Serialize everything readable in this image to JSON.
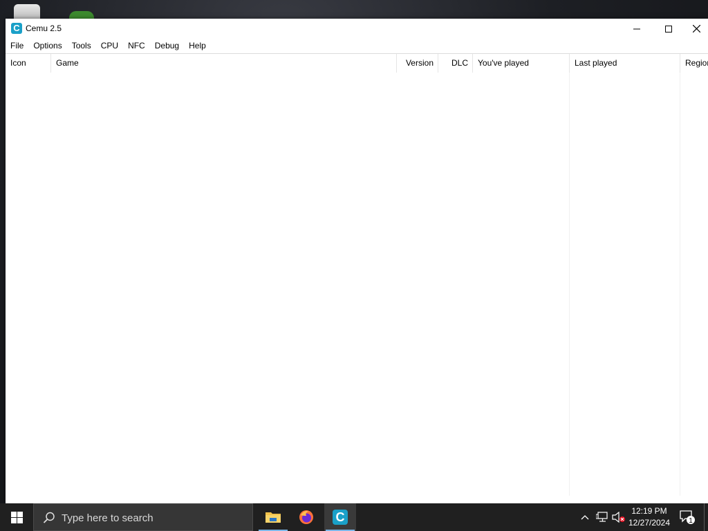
{
  "window": {
    "title": "Cemu 2.5",
    "app_icon_letter": "C"
  },
  "menu": {
    "items": [
      "File",
      "Options",
      "Tools",
      "CPU",
      "NFC",
      "Debug",
      "Help"
    ]
  },
  "game_list": {
    "columns": [
      "Icon",
      "Game",
      "Version",
      "DLC",
      "You've played",
      "Last played",
      "Region"
    ],
    "rows": []
  },
  "taskbar": {
    "search_placeholder": "Type here to search",
    "pinned": [
      {
        "name": "File Explorer",
        "icon": "folder-icon"
      },
      {
        "name": "Firefox",
        "icon": "firefox-icon"
      },
      {
        "name": "Cemu",
        "icon": "cemu-icon",
        "letter": "C"
      }
    ],
    "clock": {
      "time": "12:19 PM",
      "date": "12/27/2024"
    },
    "notification_count": "1"
  },
  "colors": {
    "cemu_accent": "#1aa0c8",
    "taskbar_bg": "#202020",
    "active_underline": "#7ab6e8"
  }
}
